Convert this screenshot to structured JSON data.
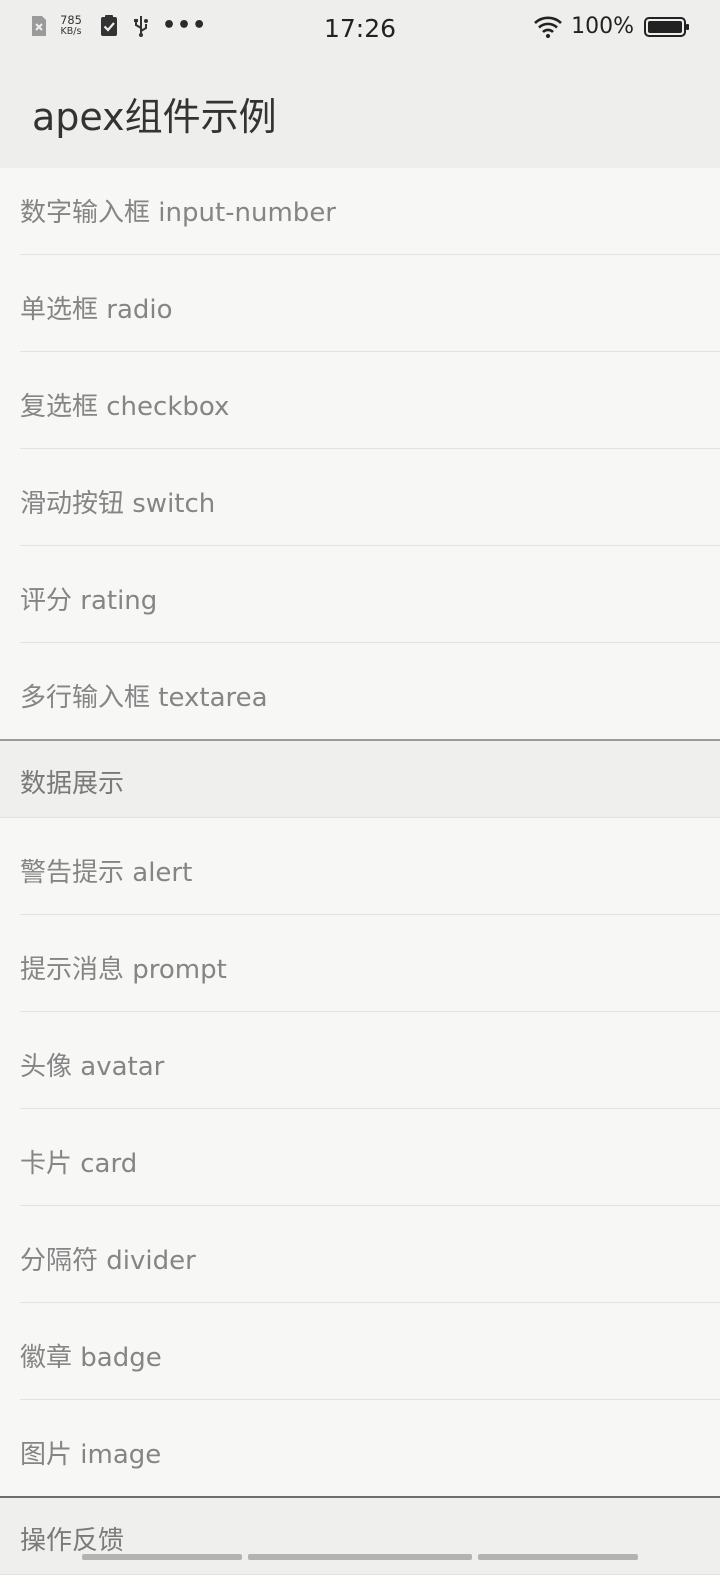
{
  "status_bar": {
    "net_speed_value": "785",
    "net_speed_unit": "KB/s",
    "more": "•••",
    "time": "17:26",
    "battery": "100%"
  },
  "app_title": "apex组件示例",
  "top_items": [
    {
      "label": "数字输入框 input-number"
    },
    {
      "label": "单选框 radio"
    },
    {
      "label": "复选框 checkbox"
    },
    {
      "label": "滑动按钮 switch"
    },
    {
      "label": "评分 rating"
    },
    {
      "label": "多行输入框 textarea"
    }
  ],
  "section_data": {
    "label": "数据展示"
  },
  "data_items": [
    {
      "label": "警告提示 alert"
    },
    {
      "label": "提示消息 prompt"
    },
    {
      "label": "头像 avatar"
    },
    {
      "label": "卡片 card"
    },
    {
      "label": "分隔符 divider"
    },
    {
      "label": "徽章 badge"
    },
    {
      "label": "图片 image"
    }
  ],
  "section_feedback": {
    "label": "操作反馈"
  }
}
